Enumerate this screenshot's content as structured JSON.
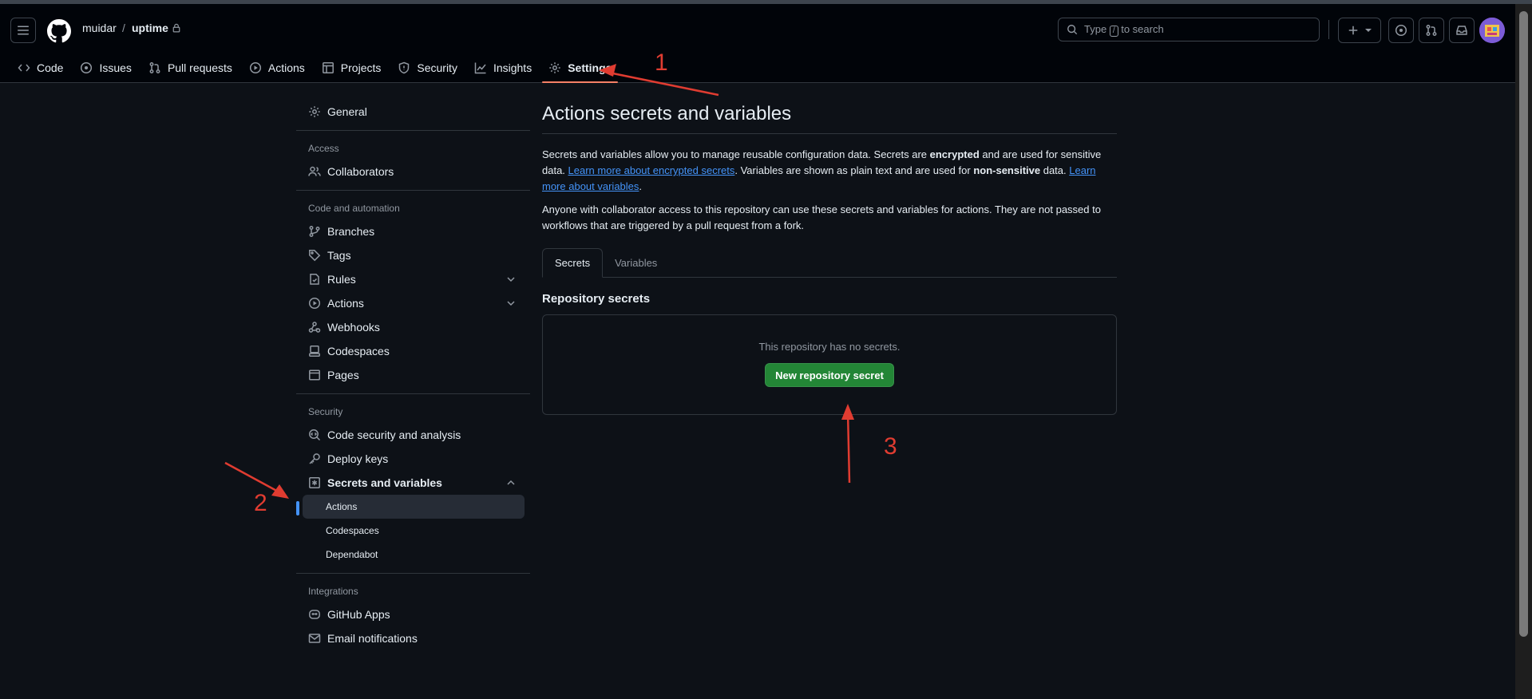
{
  "repo": {
    "owner": "muidar",
    "separator": "/",
    "name": "uptime"
  },
  "search": {
    "pre": "Type",
    "key": "/",
    "post": "to search"
  },
  "nav": [
    {
      "label": "Code",
      "icon": "code-icon"
    },
    {
      "label": "Issues",
      "icon": "issue-icon"
    },
    {
      "label": "Pull requests",
      "icon": "pull-request-icon"
    },
    {
      "label": "Actions",
      "icon": "play-icon"
    },
    {
      "label": "Projects",
      "icon": "table-icon"
    },
    {
      "label": "Security",
      "icon": "shield-icon"
    },
    {
      "label": "Insights",
      "icon": "graph-icon"
    },
    {
      "label": "Settings",
      "icon": "gear-icon"
    }
  ],
  "sidebar": {
    "general": "General",
    "access_head": "Access",
    "collaborators": "Collaborators",
    "code_head": "Code and automation",
    "branches": "Branches",
    "tags": "Tags",
    "rules": "Rules",
    "actions": "Actions",
    "webhooks": "Webhooks",
    "codespaces": "Codespaces",
    "pages": "Pages",
    "security_head": "Security",
    "code_security": "Code security and analysis",
    "deploy_keys": "Deploy keys",
    "secrets": "Secrets and variables",
    "sub_actions": "Actions",
    "sub_codespaces": "Codespaces",
    "sub_dependabot": "Dependabot",
    "integrations_head": "Integrations",
    "github_apps": "GitHub Apps",
    "email": "Email notifications"
  },
  "main": {
    "title": "Actions secrets and variables",
    "p1_a": "Secrets and variables allow you to manage reusable configuration data. Secrets are ",
    "p1_b": "encrypted",
    "p1_c": " and are used for sensitive data. ",
    "p1_link1": "Learn more about encrypted secrets",
    "p1_d": ". Variables are shown as plain text and are used for ",
    "p1_e": "non-sensitive",
    "p1_f": " data. ",
    "p1_link2": "Learn more about variables",
    "p1_g": ".",
    "p2": "Anyone with collaborator access to this repository can use these secrets and variables for actions. They are not passed to workflows that are triggered by a pull request from a fork.",
    "tab_secrets": "Secrets",
    "tab_variables": "Variables",
    "section": "Repository secrets",
    "empty": "This repository has no secrets.",
    "new_button": "New repository secret"
  },
  "annotations": {
    "one": "1",
    "two": "2",
    "three": "3"
  },
  "colors": {
    "accent": "#f78166",
    "link": "#4493f8",
    "button": "#238636",
    "annotation": "#e03c31"
  }
}
